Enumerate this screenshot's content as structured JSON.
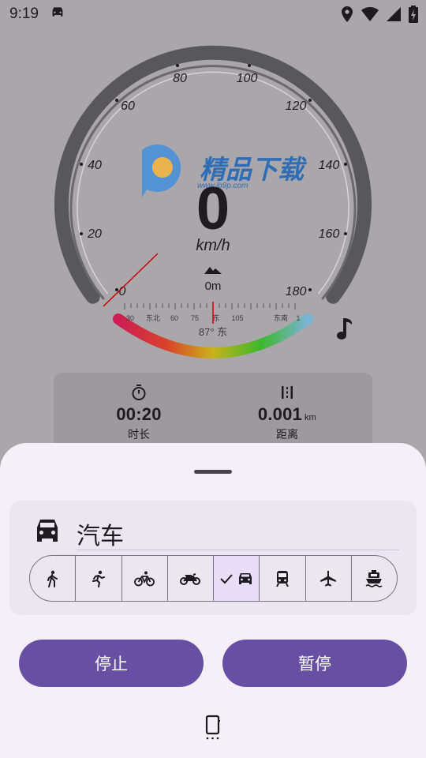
{
  "status_bar": {
    "time": "9:19",
    "icons": [
      "car-icon",
      "location-icon",
      "wifi-icon",
      "signal-icon",
      "battery-charging-icon"
    ]
  },
  "speedometer": {
    "speed": "0",
    "unit": "km/h",
    "altitude": "0m",
    "scale_labels": [
      "0",
      "20",
      "40",
      "60",
      "80",
      "100",
      "120",
      "140",
      "160",
      "180"
    ],
    "compass_ticks": [
      "30",
      "东北",
      "60",
      "75",
      "东",
      "105",
      "东南",
      "1"
    ],
    "heading": "87° 东",
    "watermark_title": "精品下载",
    "watermark_url": "www.jb9p.com"
  },
  "stats": {
    "duration_value": "00:20",
    "duration_label": "时长",
    "distance_value": "0.001",
    "distance_unit": "km",
    "distance_label": "距离"
  },
  "sheet": {
    "vehicle_name": "汽车",
    "modes": [
      {
        "icon": "walk-icon",
        "selected": false
      },
      {
        "icon": "run-icon",
        "selected": false
      },
      {
        "icon": "bike-icon",
        "selected": false
      },
      {
        "icon": "motorcycle-icon",
        "selected": false
      },
      {
        "icon": "car-icon",
        "selected": true
      },
      {
        "icon": "train-icon",
        "selected": false
      },
      {
        "icon": "airplane-icon",
        "selected": false
      },
      {
        "icon": "ship-icon",
        "selected": false
      }
    ],
    "stop_label": "停止",
    "pause_label": "暂停"
  },
  "colors": {
    "primary": "#6750a4",
    "sheet_bg": "#f5eff7",
    "selected_seg": "#e8def8",
    "needle": "#cc0000"
  }
}
